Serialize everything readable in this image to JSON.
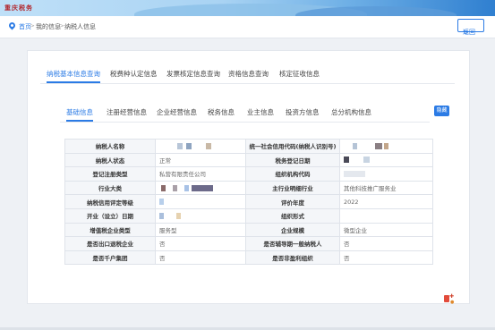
{
  "app": {
    "logo_text": "重庆税务"
  },
  "breadcrumb": {
    "home": "首页",
    "sep": ">",
    "mine": "我的信息",
    "current": "纳税人信息"
  },
  "back_button": {
    "icon": "back-arrow-icon",
    "label": "返回"
  },
  "top_tabs": [
    {
      "label": "纳税基本信息查询",
      "active": true
    },
    {
      "label": "税费种认定信息",
      "active": false
    },
    {
      "label": "发票核定信息查询",
      "active": false
    },
    {
      "label": "资格信息查询",
      "active": false
    },
    {
      "label": "核定征收信息",
      "active": false
    }
  ],
  "sub_tabs": [
    {
      "label": "基础信息",
      "active": true
    },
    {
      "label": "注册经营信息",
      "active": false
    },
    {
      "label": "企业经营信息",
      "active": false
    },
    {
      "label": "税务信息",
      "active": false
    },
    {
      "label": "业主信息",
      "active": false
    },
    {
      "label": "投资方信息",
      "active": false
    },
    {
      "label": "总分机构信息",
      "active": false
    }
  ],
  "side_button": {
    "label": "隐藏"
  },
  "colors": {
    "accent": "#2b7be5",
    "label_bg": "#f4f6f9",
    "border": "#dfe3ea",
    "brand_red": "#b2262c"
  },
  "table": {
    "rows": [
      {
        "l1": "纳税人名称",
        "v1": "",
        "l2": "统一社会信用代码(纳税人识别号)",
        "v2": ""
      },
      {
        "l1": "纳税人状态",
        "v1": "正常",
        "l2": "税务登记日期",
        "v2": ""
      },
      {
        "l1": "登记注册类型",
        "v1": "私营有限责任公司",
        "l2": "组织机构代码",
        "v2": ""
      },
      {
        "l1": "行业大类",
        "v1": "",
        "l2": "主行业明细行业",
        "v2": "其他科技推广服务业"
      },
      {
        "l1": "纳税信用评定等级",
        "v1": "",
        "l2": "评价年度",
        "v2": "2022"
      },
      {
        "l1": "开业（设立）日期",
        "v1": "",
        "l2": "组织形式",
        "v2": ""
      },
      {
        "l1": "增值税企业类型",
        "v1": "服务型",
        "l2": "企业规模",
        "v2": "微型企业"
      },
      {
        "l1": "是否出口退税企业",
        "v1": "否",
        "l2": "是否辅导期一般纳税人",
        "v2": "否"
      },
      {
        "l1": "是否千户集团",
        "v1": "否",
        "l2": "是否非盈利组织",
        "v2": "否"
      }
    ]
  }
}
